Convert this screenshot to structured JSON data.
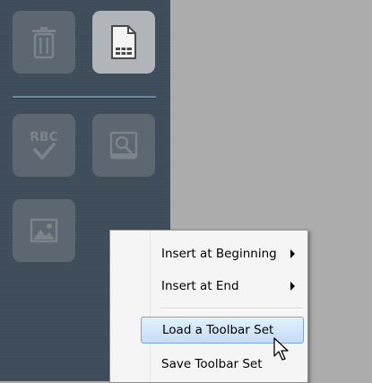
{
  "toolbar": {
    "buttons": [
      {
        "name": "delete",
        "icon": "trash-icon",
        "state": "disabled"
      },
      {
        "name": "new-document",
        "icon": "document-icon",
        "state": "active"
      },
      {
        "name": "spell-check",
        "icon": "spellcheck-abc-icon",
        "label": "RBC",
        "state": "disabled"
      },
      {
        "name": "find",
        "icon": "magnifier-icon",
        "state": "disabled"
      },
      {
        "name": "insert-image",
        "icon": "image-icon",
        "state": "disabled"
      }
    ]
  },
  "context_menu": {
    "items": [
      {
        "label": "Insert at Beginning",
        "has_submenu": true
      },
      {
        "label": "Insert at End",
        "has_submenu": true
      },
      {
        "label": "Load a Toolbar Set",
        "highlighted": true
      },
      {
        "label": "Save Toolbar Set"
      }
    ]
  },
  "colors": {
    "panel": "#3f4d5b",
    "workspace": "#acacac",
    "highlight_border": "#7ea4d6"
  }
}
